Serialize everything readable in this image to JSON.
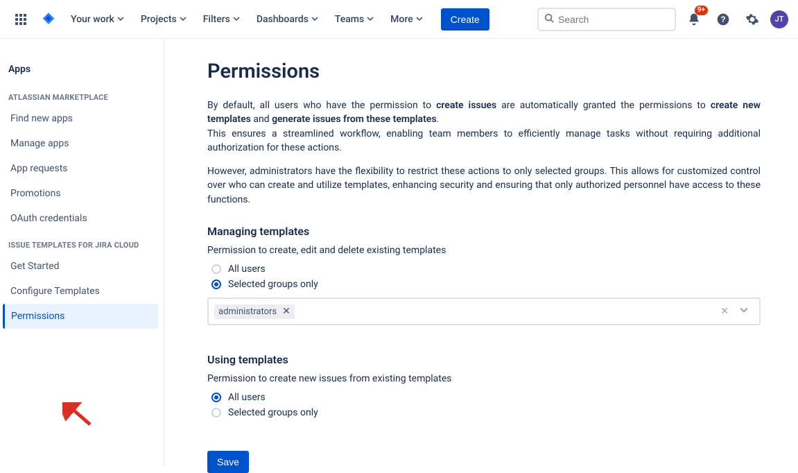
{
  "topnav": {
    "items": [
      "Your work",
      "Projects",
      "Filters",
      "Dashboards",
      "Teams",
      "More"
    ],
    "create": "Create",
    "search_placeholder": "Search",
    "badge": "9+",
    "avatar": "JT"
  },
  "sidebar": {
    "title": "Apps",
    "section1": {
      "header": "ATLASSIAN MARKETPLACE",
      "items": [
        "Find new apps",
        "Manage apps",
        "App requests",
        "Promotions",
        "OAuth credentials"
      ]
    },
    "section2": {
      "header": "ISSUE TEMPLATES FOR JIRA CLOUD",
      "items": [
        "Get Started",
        "Configure Templates",
        "Permissions"
      ]
    }
  },
  "main": {
    "title": "Permissions",
    "intro": {
      "p1a": "By default, all users who have the permission to ",
      "p1b": "create issues",
      "p1c": " are automatically granted the permissions to ",
      "p1d": "create new templates",
      "p1e": " and ",
      "p1f": "generate issues from these templates",
      "p1g": ".",
      "p2": "This ensures a streamlined workflow, enabling team members to efficiently manage tasks without requiring additional authorization for these actions.",
      "p3": "However, administrators have the flexibility to restrict these actions to only selected groups. This allows for customized control over who can create and utilize templates, enhancing security and ensuring that only authorized personnel have access to these functions."
    },
    "managing": {
      "heading": "Managing templates",
      "desc": "Permission to create, edit and delete existing templates",
      "opt_all": "All users",
      "opt_sel": "Selected groups only",
      "selected_tag": "administrators"
    },
    "using": {
      "heading": "Using templates",
      "desc": "Permission to create new issues from existing templates",
      "opt_all": "All users",
      "opt_sel": "Selected groups only"
    },
    "save": "Save"
  }
}
